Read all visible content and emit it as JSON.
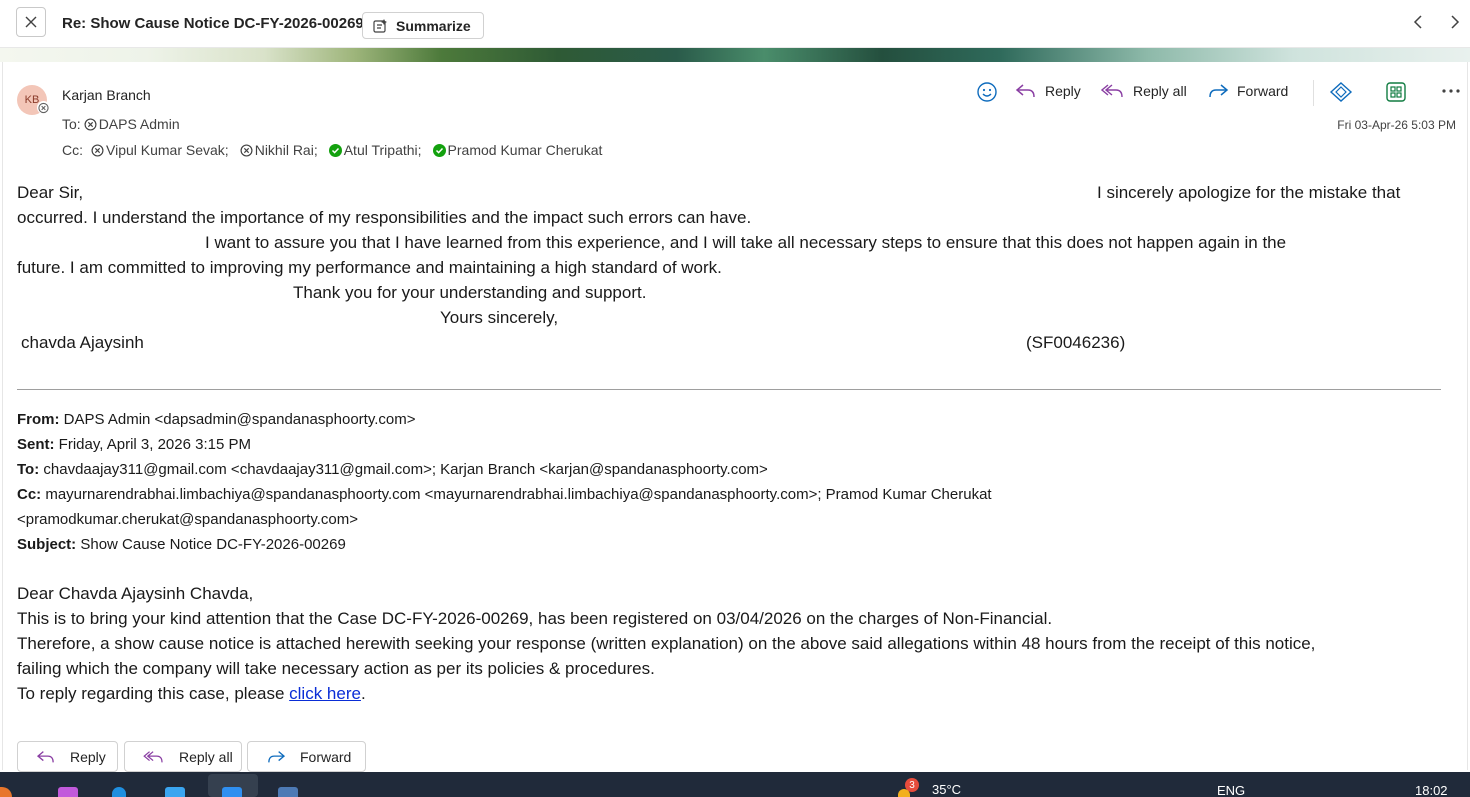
{
  "titlebar": {
    "title": "Re: Show Cause Notice DC-FY-2026-00269",
    "summarize_label": "Summarize"
  },
  "message": {
    "avatar_initials": "KB",
    "sender": "Karjan Branch",
    "to_label": "To:",
    "to": [
      {
        "name": "DAPS Admin",
        "status": "unknown"
      }
    ],
    "cc_label": "Cc:",
    "cc": [
      {
        "name": "Vipul Kumar Sevak;",
        "status": "unknown"
      },
      {
        "name": "Nikhil Rai;",
        "status": "unknown"
      },
      {
        "name": "Atul Tripathi;",
        "status": "available"
      },
      {
        "name": "Pramod Kumar Cherukat",
        "status": "available"
      }
    ],
    "date": "Fri 03-Apr-26 5:03 PM",
    "actions": {
      "reply": "Reply",
      "reply_all": "Reply all",
      "forward": "Forward"
    },
    "body": {
      "greeting": "Dear Sir,",
      "line1_right": "I sincerely apologize for the mistake that",
      "line2": "occurred. I understand the importance of my responsibilities and the impact such errors can have.",
      "line3": "I want to assure you that I have learned from this experience, and I will take all  necessary steps to ensure that this does not happen again in the",
      "line4": "future. I am committed to improving my performance and maintaining a high standard of work.",
      "line5": "Thank you for your understanding and support.",
      "line6": "Yours sincerely,",
      "signature": "chavda Ajaysinh",
      "employee_id": "(SF0046236)"
    }
  },
  "quoted": {
    "from_label": "From:",
    "from": "DAPS Admin <dapsadmin@spandanasphoorty.com>",
    "sent_label": "Sent:",
    "sent": "Friday, April 3, 2026 3:15 PM",
    "to_label": "To:",
    "to": "chavdaajay311@gmail.com <chavdaajay311@gmail.com>; Karjan Branch <karjan@spandanasphoorty.com>",
    "cc_label": "Cc:",
    "cc_line1": "mayurnarendrabhai.limbachiya@spandanasphoorty.com <mayurnarendrabhai.limbachiya@spandanasphoorty.com>; Pramod Kumar Cherukat",
    "cc_line2": "<pramodkumar.cherukat@spandanasphoorty.com>",
    "subject_label": "Subject:",
    "subject": "Show Cause Notice DC-FY-2026-00269",
    "body": {
      "greeting": "Dear Chavda Ajaysinh Chavda,",
      "line1": "This is to bring your kind attention that the Case DC-FY-2026-00269, has been registered on 03/04/2026 on the charges of Non-Financial.",
      "line2": "Therefore, a show cause notice is attached herewith seeking your response (written explanation) on the above said allegations within 48 hours from the receipt of this notice,",
      "line3": "failing which the company will take necessary action as per its policies & procedures.",
      "line4_prefix": "To reply regarding this case, please ",
      "link": "click here",
      "line4_suffix": "."
    }
  },
  "bottom_actions": {
    "reply": "Reply",
    "reply_all": "Reply all",
    "forward": "Forward"
  },
  "taskbar": {
    "weather_badge": "3",
    "temperature": "35°C",
    "language": "ENG",
    "time": "18:02"
  },
  "colors": {
    "accent": "#0f6cbd",
    "link": "#0a2dd6",
    "presence_available": "#13a10e",
    "taskbar": "#202a3a"
  }
}
